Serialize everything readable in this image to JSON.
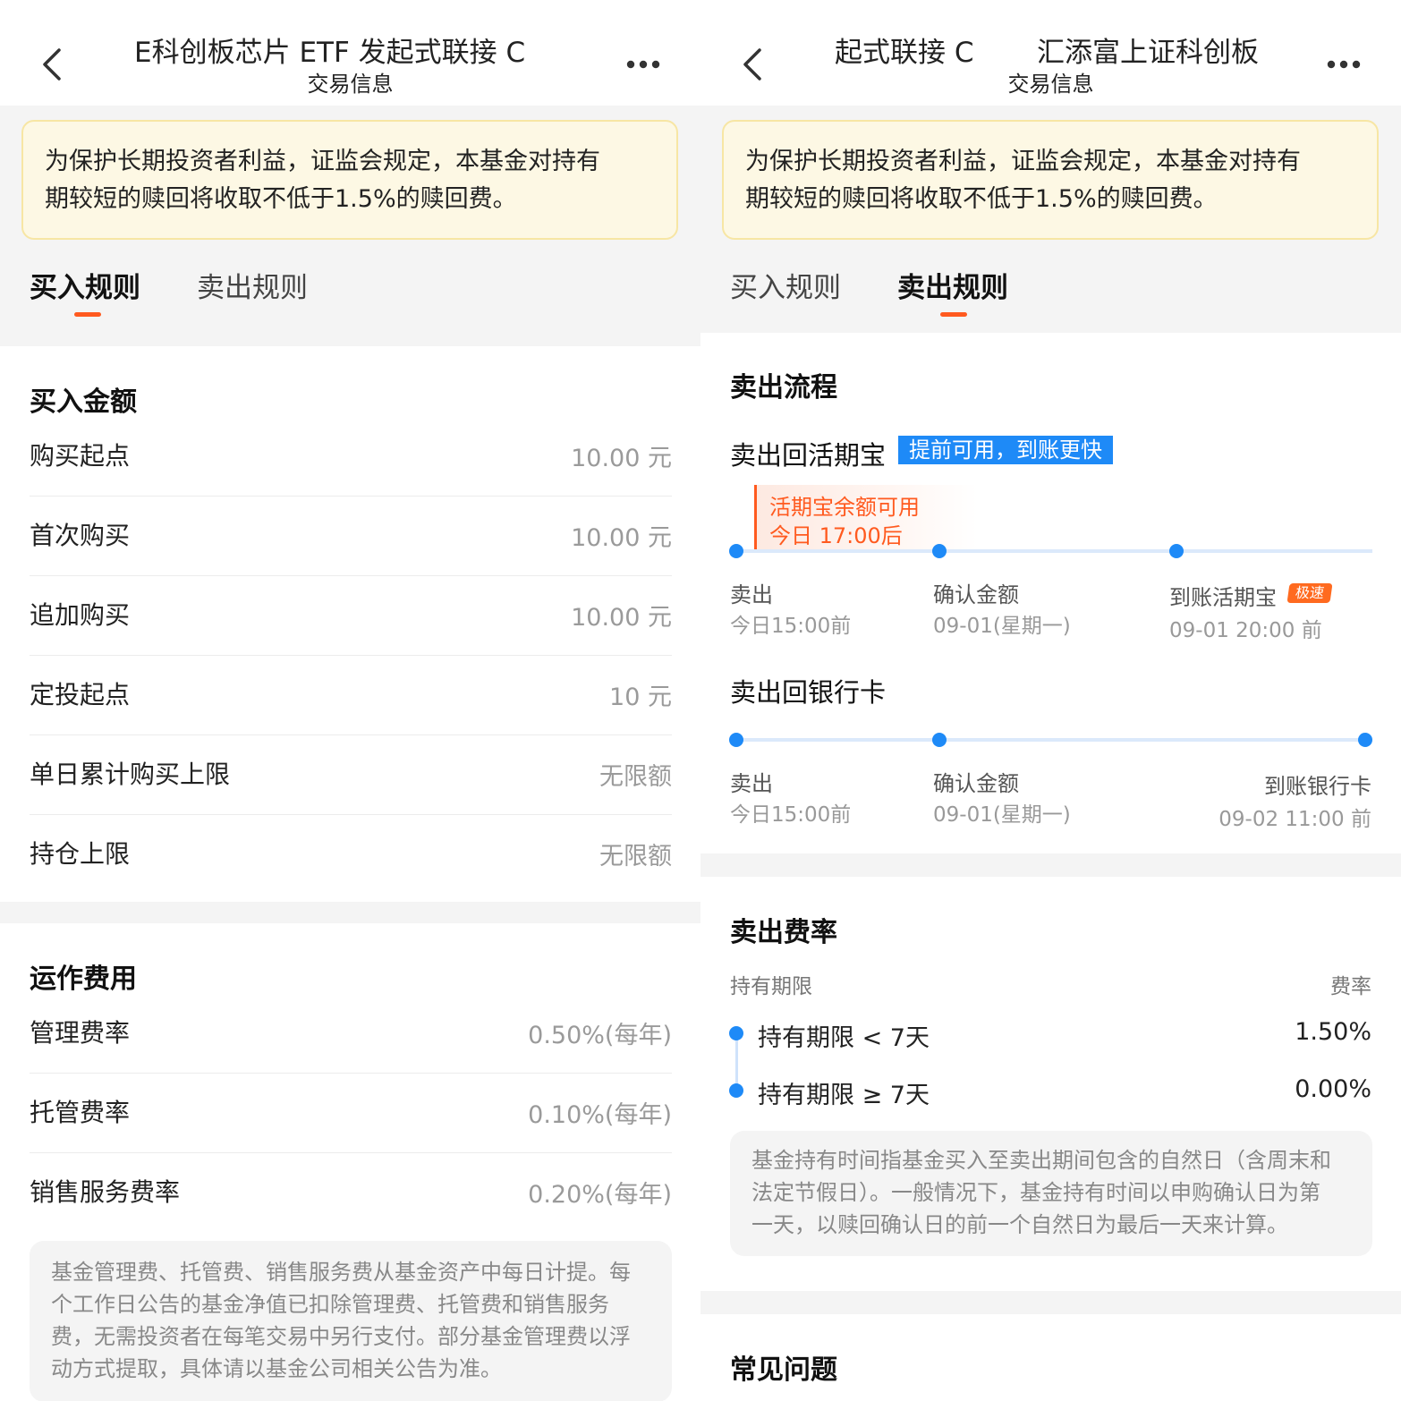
{
  "left": {
    "header": {
      "title_left": "E科创板芯片 ETF 发起式联接 C",
      "subtitle": "交易信息"
    },
    "notice": {
      "line1": "为保护长期投资者利益，证监会规定，本基金对持有",
      "line2": "期较短的赎回将收取不低于1.5%的赎回费。"
    },
    "tabs": [
      {
        "label": "买入规则",
        "active": true
      },
      {
        "label": "卖出规则",
        "active": false
      }
    ],
    "buy_amount": {
      "title": "买入金额",
      "rows": [
        {
          "label": "购买起点",
          "value": "10.00 元"
        },
        {
          "label": "首次购买",
          "value": "10.00 元"
        },
        {
          "label": "追加购买",
          "value": "10.00 元"
        },
        {
          "label": "定投起点",
          "value": "10 元"
        },
        {
          "label": "单日累计购买上限",
          "value": "无限额"
        },
        {
          "label": "持仓上限",
          "value": "无限额"
        }
      ]
    },
    "operating_fees": {
      "title": "运作费用",
      "rows": [
        {
          "label": "管理费率",
          "value": "0.50%(每年)"
        },
        {
          "label": "托管费率",
          "value": "0.10%(每年)"
        },
        {
          "label": "销售服务费率",
          "value": "0.20%(每年)"
        }
      ],
      "note_lines": [
        "基金管理费、托管费、销售服务费从基金资产中每日计提。每",
        "个工作日公告的基金净值已扣除管理费、托管费和销售服务",
        "费，无需投资者在每笔交易中另行支付。部分基金管理费以浮",
        "动方式提取，具体请以基金公司相关公告为准。"
      ]
    }
  },
  "right": {
    "header": {
      "title_part1": "起式联接 C",
      "title_part2": "汇添富上证科创板",
      "subtitle": "交易信息"
    },
    "notice": {
      "line1": "为保护长期投资者利益，证监会规定，本基金对持有",
      "line2": "期较短的赎回将收取不低于1.5%的赎回费。"
    },
    "tabs": [
      {
        "label": "买入规则",
        "active": false
      },
      {
        "label": "卖出规则",
        "active": true
      }
    ],
    "sell_flow": {
      "title": "卖出流程",
      "to_wallet": {
        "title": "卖出回活期宝",
        "tag": "提前可用，到账更快",
        "callout_line1": "活期宝余额可用",
        "callout_line2": "今日 17:00后",
        "steps": [
          {
            "label": "卖出",
            "time": "今日15:00前"
          },
          {
            "label": "确认金额",
            "time": "09-01(星期一)"
          },
          {
            "label": "到账活期宝",
            "time": "09-01 20:00 前",
            "badge": "极速"
          }
        ]
      },
      "to_bank": {
        "title": "卖出回银行卡",
        "steps": [
          {
            "label": "卖出",
            "time": "今日15:00前"
          },
          {
            "label": "确认金额",
            "time": "09-01(星期一)"
          },
          {
            "label": "到账银行卡",
            "time": "09-02 11:00 前"
          }
        ]
      }
    },
    "sell_fee": {
      "title": "卖出费率",
      "col_period": "持有期限",
      "col_rate": "费率",
      "rows": [
        {
          "label": "持有期限 < 7天",
          "value": "1.50%"
        },
        {
          "label": "持有期限 ≥ 7天",
          "value": "0.00%"
        }
      ],
      "note_lines": [
        "基金持有时间指基金买入至卖出期间包含的自然日（含周末和",
        "法定节假日）。一般情况下，基金持有时间以申购确认日为第",
        "一天，以赎回确认日的前一个自然日为最后一天来计算。"
      ]
    },
    "faq": {
      "title": "常见问题"
    }
  },
  "colors": {
    "accent_orange": "#ff5a1f",
    "accent_blue": "#1e8af7",
    "notice_bg": "#fdf8e4"
  }
}
